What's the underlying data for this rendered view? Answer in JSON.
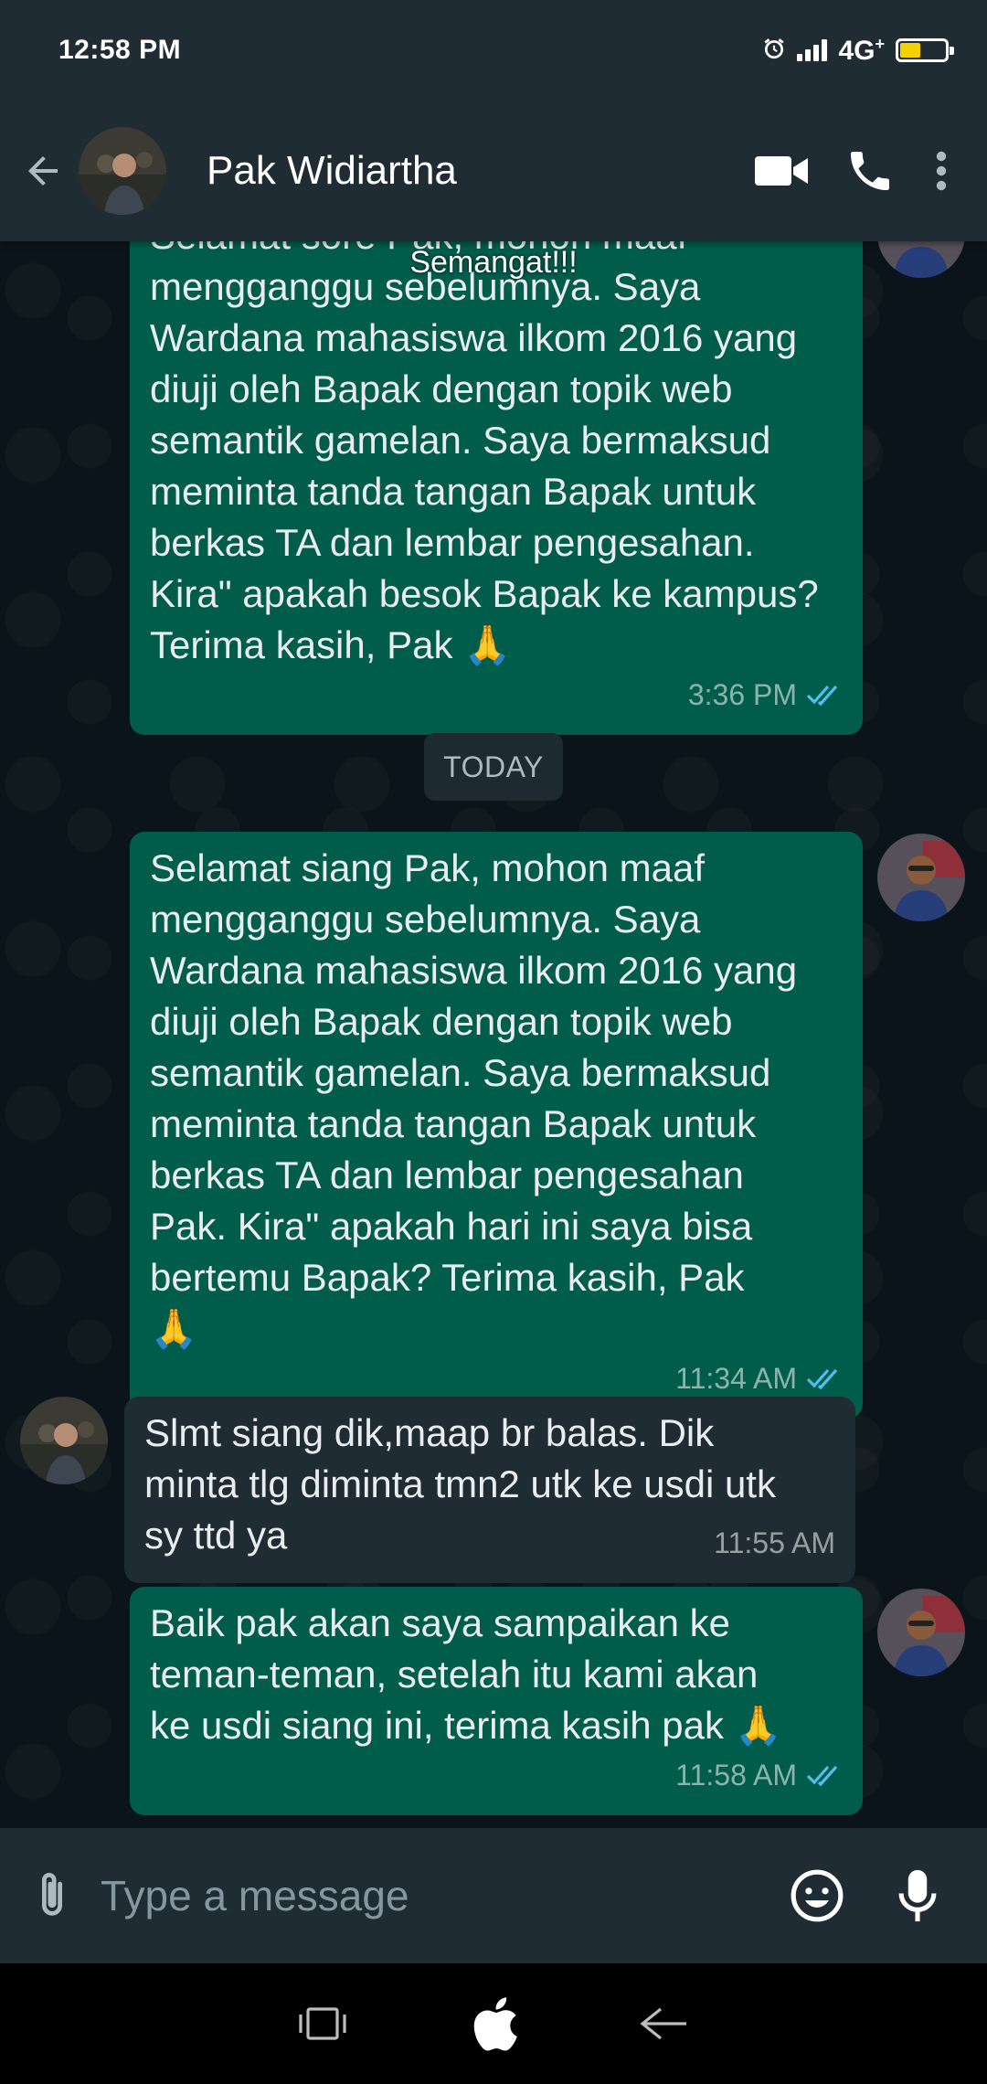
{
  "status_bar": {
    "time": "12:58 PM",
    "network": "4G",
    "network_plus": "+",
    "battery_level": 0.45
  },
  "header": {
    "contact_name": "Pak Widiartha",
    "icons": [
      "back-arrow-icon",
      "video-call-icon",
      "phone-icon",
      "more-vert-icon"
    ]
  },
  "chat": {
    "top_label": "Semangat!!!",
    "date_separator": "TODAY",
    "messages": [
      {
        "direction": "out",
        "text": "Selamat sore Pak, mohon maaf\nmengganggu sebelumnya. Saya\nWardana mahasiswa ilkom 2016 yang\ndiuji oleh Bapak dengan topik web\nsemantik gamelan. Saya bermaksud\nmeminta tanda tangan Bapak untuk\nberkas TA dan lembar pengesahan.\nKira\" apakah besok Bapak ke kampus?\nTerima kasih, Pak",
        "emoji": "🙏",
        "time": "3:36 PM",
        "status": "read"
      },
      {
        "direction": "out",
        "text": "Selamat siang Pak, mohon maaf\nmengganggu sebelumnya. Saya\nWardana mahasiswa ilkom 2016 yang\ndiuji oleh Bapak dengan topik web\nsemantik gamelan. Saya bermaksud\nmeminta tanda tangan Bapak untuk\nberkas TA dan lembar pengesahan\nPak. Kira\" apakah hari ini saya bisa\nbertemu Bapak? Terima kasih, Pak",
        "emoji": "🙏",
        "time": "11:34 AM",
        "status": "read"
      },
      {
        "direction": "in",
        "text": "Slmt siang dik,maap br balas. Dik\nminta tlg diminta tmn2 utk ke usdi utk\nsy ttd ya",
        "time": "11:55 AM"
      },
      {
        "direction": "out",
        "text": "Baik pak akan saya sampaikan ke\nteman-teman, setelah itu kami akan\nke usdi siang ini, terima kasih pak",
        "emoji": "🙏",
        "time": "11:58 AM",
        "status": "read"
      }
    ]
  },
  "composer": {
    "placeholder": "Type a message",
    "icons": [
      "attach-icon",
      "emoji-icon",
      "mic-icon"
    ]
  },
  "colors": {
    "app_bar": "#1f2c34",
    "chat_bg": "#0b141a",
    "outgoing_bubble": "#005c4b",
    "incoming_bubble": "#202c33",
    "read_tick": "#53bdeb"
  }
}
